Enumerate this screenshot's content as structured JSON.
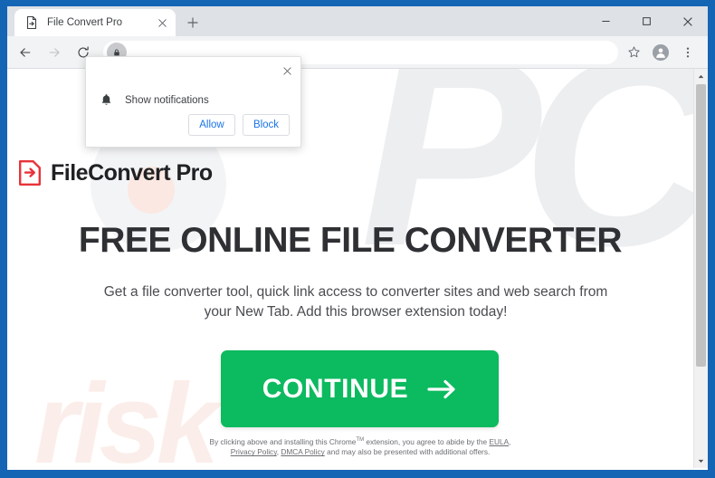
{
  "browser": {
    "tab": {
      "title": "File Convert Pro",
      "favicon_icon": "file-convert-icon",
      "close_icon": "close-icon"
    },
    "new_tab_icon": "plus-icon",
    "window_controls": {
      "minimize_icon": "minimize-icon",
      "maximize_icon": "maximize-icon",
      "close_icon": "close-icon"
    },
    "toolbar": {
      "back_icon": "back-arrow-icon",
      "forward_icon": "forward-arrow-icon",
      "reload_icon": "reload-icon",
      "security_icon": "lock-icon",
      "url": "",
      "bookmark_icon": "star-icon",
      "profile_icon": "avatar-icon",
      "menu_icon": "three-dot-menu-icon"
    },
    "scrollbar": {
      "up_icon": "chevron-up-icon",
      "down_icon": "chevron-down-icon"
    }
  },
  "notification_bubble": {
    "close_icon": "close-icon",
    "bell_icon": "bell-icon",
    "message": "Show notifications",
    "allow_label": "Allow",
    "block_label": "Block"
  },
  "page": {
    "brand": {
      "icon": "file-arrow-icon",
      "name": "FileConvert Pro"
    },
    "heading": "FREE ONLINE FILE CONVERTER",
    "subheading": "Get a file converter tool, quick link access to converter sites and web search from your New Tab. Add this browser extension today!",
    "cta": {
      "label": "CONTINUE",
      "arrow_icon": "right-arrow-icon"
    },
    "legal": {
      "lead": "By clicking above and installing this Chrome",
      "trademark": "TM",
      "lead2": " extension, you agree to abide by the ",
      "eula_label": "EULA",
      "sep1": ", ",
      "privacy_label": "Privacy Policy",
      "sep2": ", ",
      "dmca_label": "DMCA Policy",
      "tail": " and may also be presented with additional offers."
    },
    "watermark": {
      "logo_text": "PCF",
      "word_text": "risk"
    }
  },
  "colors": {
    "frame_blue": "#1565b5",
    "cta_green": "#0cba5f",
    "brand_red": "#e8333a",
    "link_blue": "#1a73e8"
  }
}
